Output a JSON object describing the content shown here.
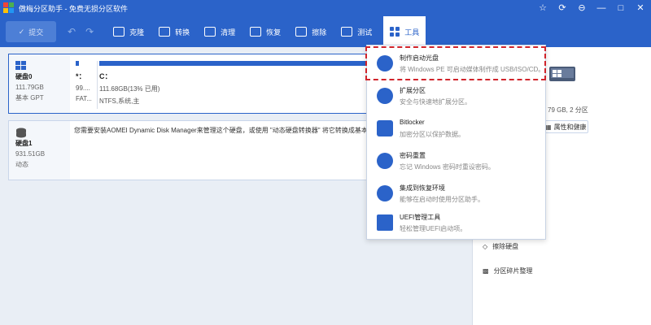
{
  "window": {
    "title": "傲梅分区助手 - 免费无损分区软件",
    "controls": [
      "☆",
      "⟳",
      "⊖",
      "—",
      "□",
      "✕"
    ]
  },
  "toolbar": {
    "submit": "提交",
    "undo": "↶",
    "redo": "↷",
    "tools": [
      "克隆",
      "转换",
      "清理",
      "恢复",
      "擦除",
      "测试"
    ],
    "active_tool": "工具"
  },
  "disks": [
    {
      "name": "硬盘0",
      "size": "111.79GB",
      "style": "基本 GPT",
      "partitions": [
        {
          "letter": "*：",
          "size": "99....",
          "fs": "FAT..."
        },
        {
          "letter": "C：",
          "size": "111.68GB(13% 已用)",
          "fs": "NTFS,系统,主"
        }
      ]
    },
    {
      "name": "硬盘1",
      "size": "931.51GB",
      "style": "动态",
      "message": "您需要安装AOMEI Dynamic Disk Manager来管理这个硬盘，或使用 \"动态硬盘转换器\" 将它转换成基本硬盘。"
    }
  ],
  "right_panel": {
    "size": "79 GB, 2 分区",
    "properties_button": "属性和健康",
    "items": [
      "擦除硬盘",
      "分区碎片整理"
    ]
  },
  "tools_menu": {
    "items": [
      {
        "title": "制作启动光盘",
        "desc": "将 Windows PE 可启动媒体制作成 USB/ISO/CD。",
        "icon": "bootable-media-icon",
        "highlighted": true
      },
      {
        "title": "扩展分区",
        "desc": "安全与快速地扩展分区。",
        "icon": "extend-partition-icon"
      },
      {
        "title": "Bitlocker",
        "desc": "加密分区以保护数据。",
        "icon": "bitlocker-icon"
      },
      {
        "title": "密码重置",
        "desc": "忘记 Windows 密码时重设密码。",
        "icon": "password-reset-icon"
      },
      {
        "title": "集成到恢复环境",
        "desc": "能够在启动时使用分区助手。",
        "icon": "recovery-env-icon"
      },
      {
        "title": "UEFI管理工具",
        "desc": "轻松管理UEFI启动项。",
        "icon": "uefi-icon"
      }
    ]
  },
  "colors": {
    "accent": "#2b63c9",
    "highlight": "#d0242b"
  }
}
